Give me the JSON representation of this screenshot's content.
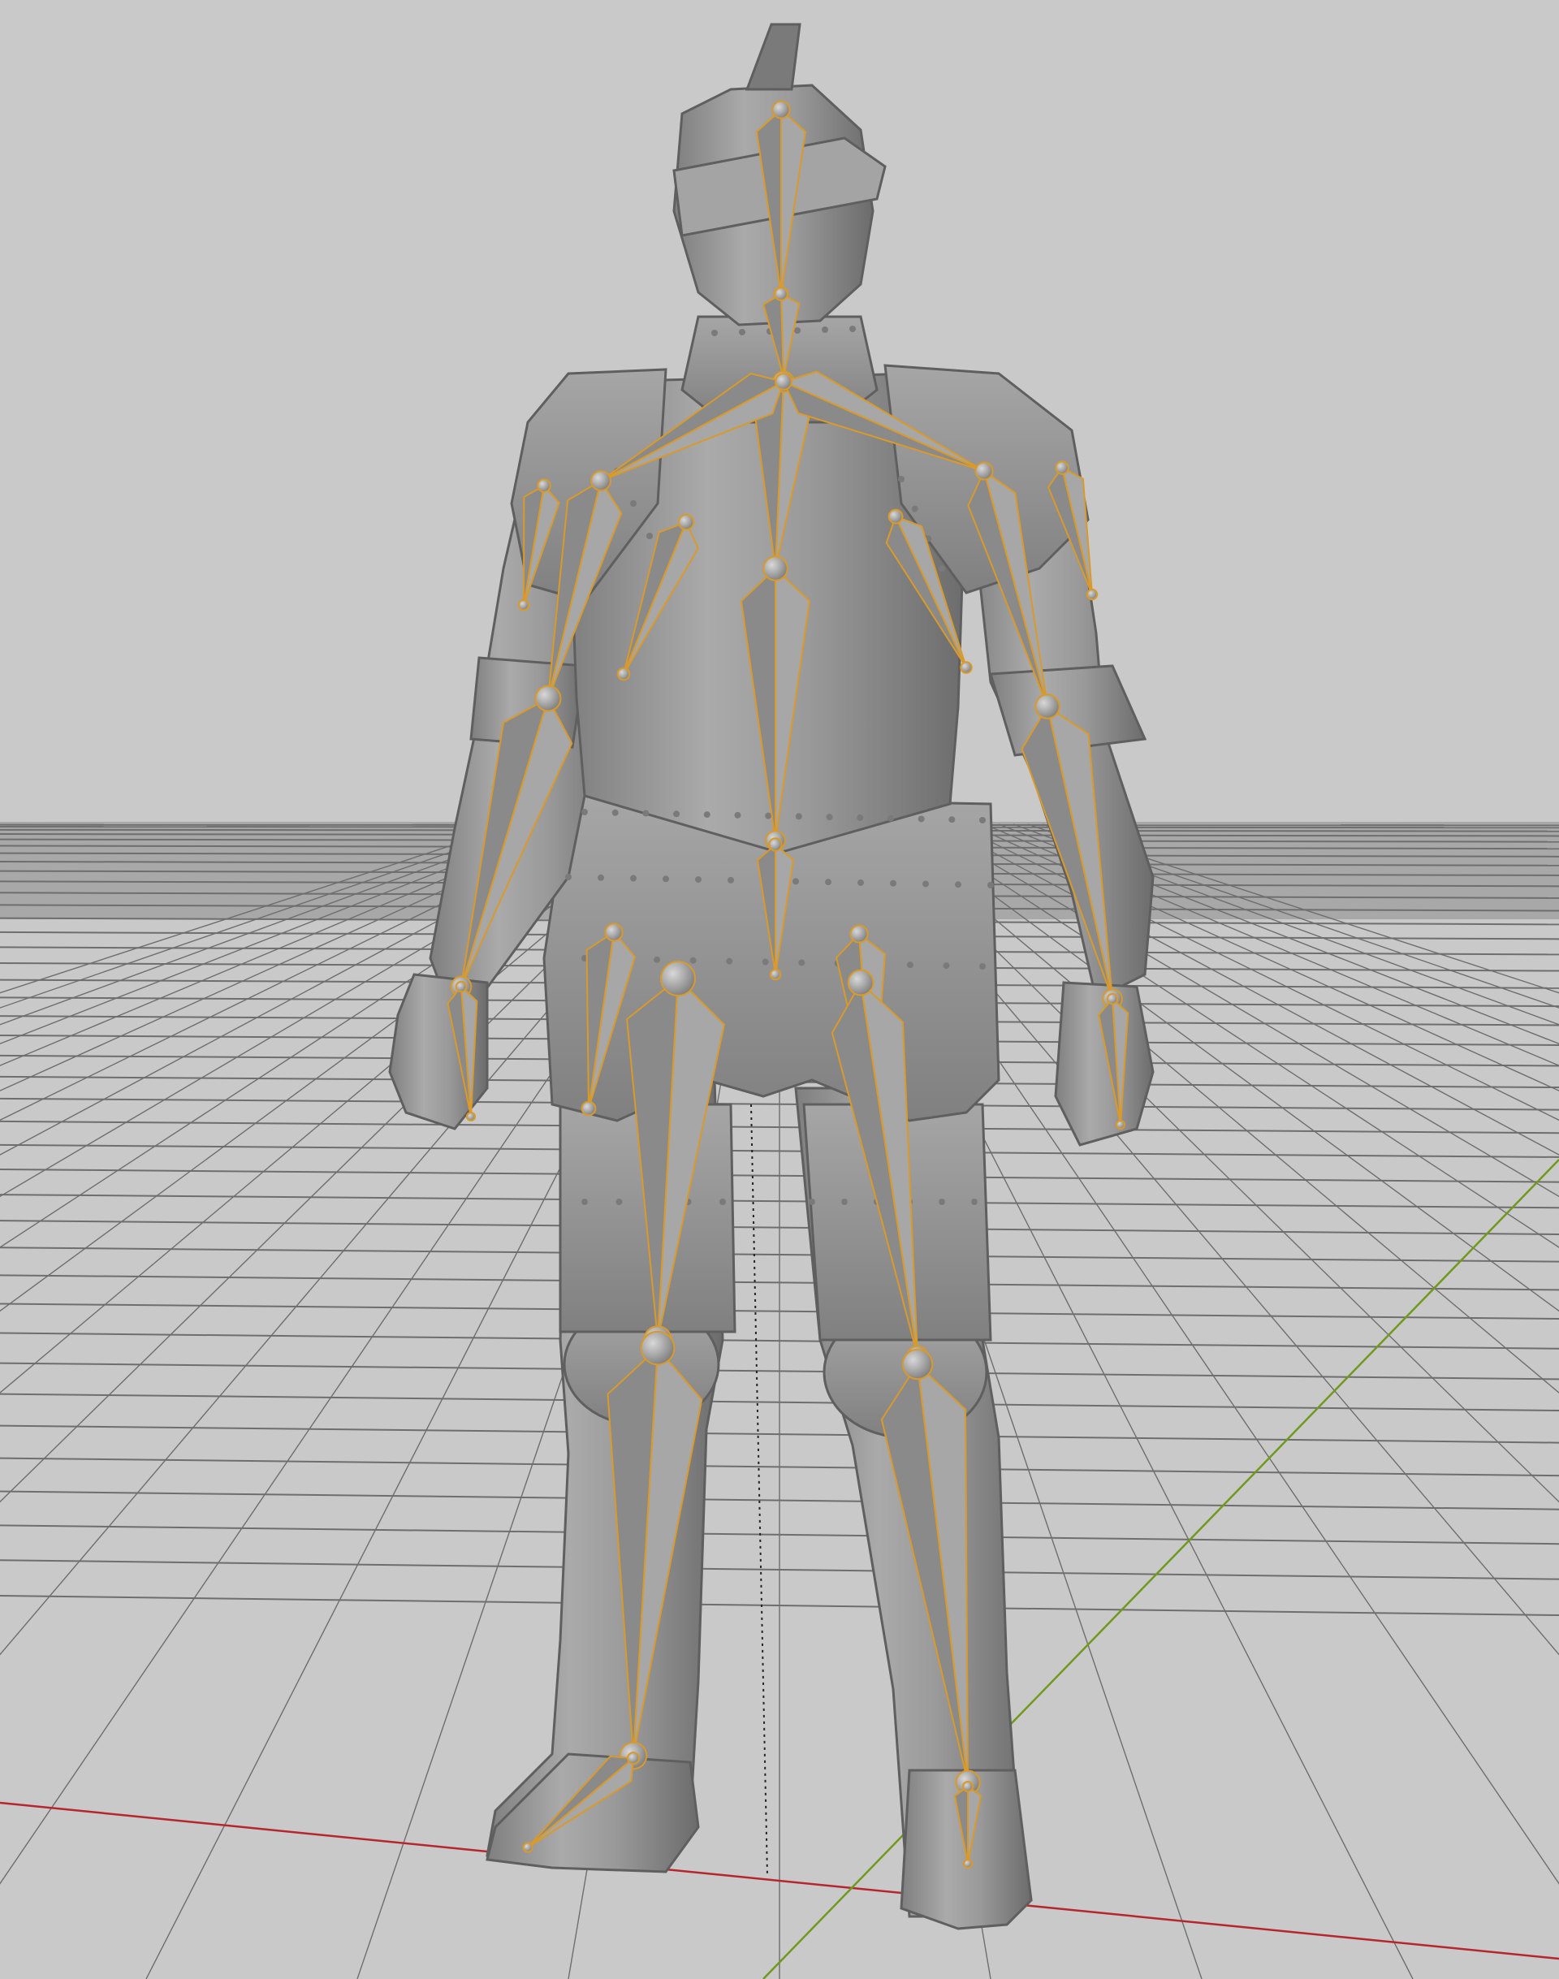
{
  "viewport": {
    "editor": "3D Viewport",
    "shading": "solid",
    "background_color": "#c9c9c9",
    "grid_line_color": "#6e6e6e",
    "x_axis_color": "#b5262e",
    "y_axis_color": "#6f9a1e",
    "object_color": "#8f8f8f",
    "object_highlight_color": "#b5b5b5",
    "bone_outline_color": "#d99a2a",
    "model": "knight-armor",
    "armature_display": "octahedral",
    "armature_bones": [
      "head",
      "neck",
      "spine-upper",
      "spine-lower",
      "clavicle-left",
      "clavicle-right",
      "upper-arm-left",
      "upper-arm-right",
      "forearm-left",
      "forearm-right",
      "hand-left",
      "hand-right",
      "thigh-left",
      "thigh-right",
      "shin-left",
      "shin-right",
      "foot-left",
      "foot-right",
      "pauldron-left",
      "pauldron-right",
      "tasset-left",
      "tasset-right"
    ]
  }
}
